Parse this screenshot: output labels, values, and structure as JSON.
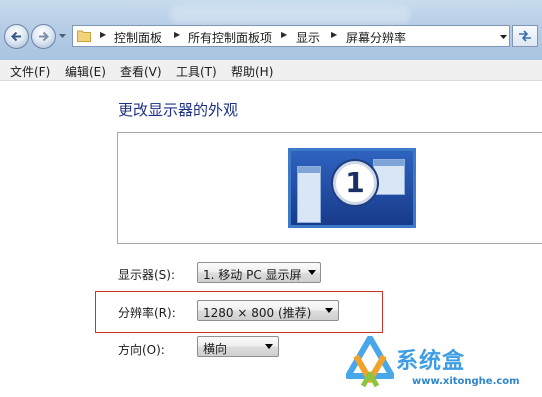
{
  "address_bar": {
    "breadcrumb": [
      "控制面板",
      "所有控制面板项",
      "显示",
      "屏幕分辨率"
    ]
  },
  "menu": {
    "items": [
      "文件(F)",
      "编辑(E)",
      "查看(V)",
      "工具(T)",
      "帮助(H)"
    ]
  },
  "main": {
    "title": "更改显示器的外观",
    "monitor_number": "1",
    "display": {
      "label": "显示器(S):",
      "value": "1. 移动 PC 显示屏"
    },
    "resolution": {
      "label": "分辨率(R):",
      "value": "1280 × 800 (推荐)"
    },
    "orientation": {
      "label": "方向(O):",
      "value": "横向"
    }
  },
  "watermark": {
    "name": "系统盒",
    "url": "www.xitonghe.com"
  },
  "colors": {
    "title_blue": "#1e3287",
    "monitor_blue": "#1a3f8e",
    "highlight_red": "#c9342e",
    "watermark_blue": "#3f9ee3"
  }
}
